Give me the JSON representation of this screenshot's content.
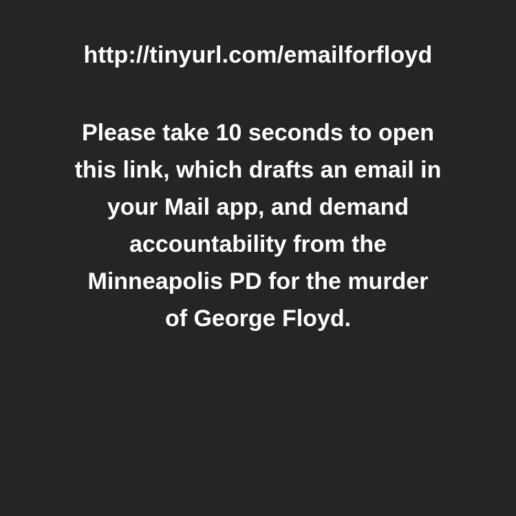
{
  "background_color": "#252525",
  "text_color": "#ffffff",
  "link_text": "http://tinyurl.com/emailforfloyd",
  "message_lines": [
    "Please take 10 seconds to open",
    "this link, which drafts an email in",
    "your Mail app, and demand",
    "accountability from the",
    "Minneapolis PD for the murder",
    "of George Floyd."
  ]
}
